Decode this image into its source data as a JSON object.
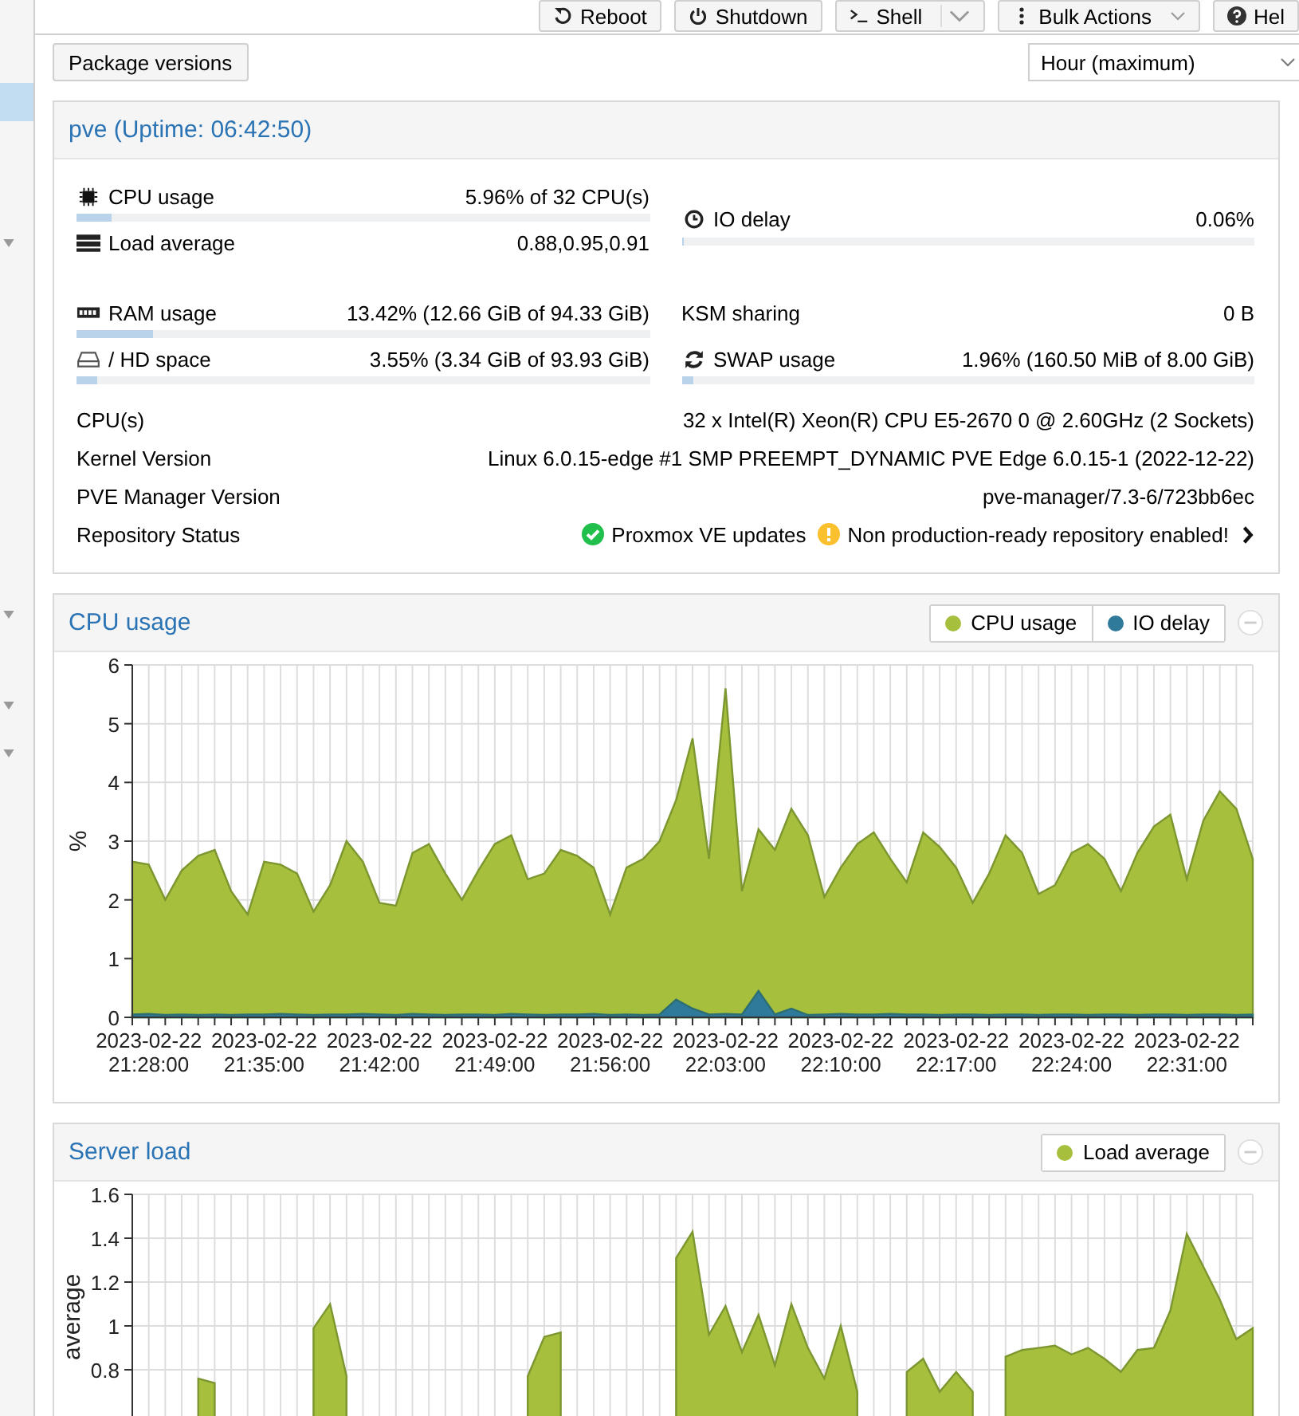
{
  "toolbar": {
    "buttons": [
      {
        "label": "Reboot",
        "kind": "plain"
      },
      {
        "label": "Shutdown",
        "kind": "plain"
      },
      {
        "label": "Shell",
        "kind": "split"
      },
      {
        "label": "Bulk Actions",
        "kind": "menu"
      },
      {
        "label": "Hel",
        "kind": "plain"
      }
    ]
  },
  "package_button": "Package versions",
  "timeframe": {
    "value": "Hour (maximum)"
  },
  "status": {
    "title": "pve (Uptime: 06:42:50)",
    "groups": [
      {
        "left": [
          {
            "label": "CPU usage",
            "value": "5.96% of 32 CPU(s)",
            "kind": "bar",
            "level": 0.06
          },
          {
            "label": "Load average",
            "value": "0.88,0.95,0.91",
            "kind": "plain"
          }
        ],
        "right": [
          {
            "label": "IO delay",
            "value": "0.06%",
            "kind": "bar",
            "level": 0.0006
          }
        ]
      },
      {
        "left": [
          {
            "label": "RAM usage",
            "value": "13.42% (12.66 GiB of 94.33 GiB)",
            "kind": "bar",
            "level": 0.1342
          },
          {
            "label": "/ HD space",
            "value": "3.55% (3.34 GiB of 93.93 GiB)",
            "kind": "bar",
            "level": 0.0355
          }
        ],
        "right": [
          {
            "label": "KSM sharing",
            "value": "0 B",
            "kind": "plain"
          },
          {
            "label": "SWAP usage",
            "value": "1.96% (160.50 MiB of 8.00 GiB)",
            "kind": "bar",
            "level": 0.0196
          }
        ]
      }
    ],
    "info": [
      {
        "label": "CPU(s)",
        "value": "32 x Intel(R) Xeon(R) CPU E5-2670 0 @ 2.60GHz (2 Sockets)"
      },
      {
        "label": "Kernel Version",
        "value": "Linux 6.0.15-edge #1 SMP PREEMPT_DYNAMIC PVE Edge 6.0.15-1 (2022-12-22)"
      },
      {
        "label": "PVE Manager Version",
        "value": "pve-manager/7.3-6/723bb6ec"
      }
    ],
    "repository": {
      "label": "Repository Status",
      "items": [
        {
          "kind": "ok",
          "text": "Proxmox VE updates"
        },
        {
          "kind": "warning",
          "text": "Non production-ready repository enabled!"
        }
      ]
    }
  },
  "panels": [
    {
      "title": "CPU usage",
      "chart_data": {
        "type": "area",
        "ylabel": "%",
        "grid": true,
        "categories": [
          null,
          "2023-02-22 21:28:00",
          null,
          null,
          null,
          null,
          null,
          null,
          "2023-02-22 21:35:00",
          null,
          null,
          null,
          null,
          null,
          null,
          "2023-02-22 21:42:00",
          null,
          null,
          null,
          null,
          null,
          null,
          "2023-02-22 21:49:00",
          null,
          null,
          null,
          null,
          null,
          null,
          "2023-02-22 21:56:00",
          null,
          null,
          null,
          null,
          null,
          null,
          "2023-02-22 22:03:00",
          null,
          null,
          null,
          null,
          null,
          null,
          "2023-02-22 22:10:00",
          null,
          null,
          null,
          null,
          null,
          null,
          "2023-02-22 22:17:00",
          null,
          null,
          null,
          null,
          null,
          null,
          "2023-02-22 22:24:00",
          null,
          null,
          null,
          null,
          null,
          null,
          "2023-02-22 22:31:00",
          null,
          null,
          null,
          null
        ],
        "series": [
          {
            "name": "CPU usage",
            "color": "#a6bf3c",
            "values": [
              2.65,
              2.6,
              2.0,
              2.5,
              2.75,
              2.85,
              2.15,
              1.75,
              2.65,
              2.6,
              2.45,
              1.8,
              2.25,
              3.0,
              2.65,
              1.95,
              1.9,
              2.8,
              2.95,
              2.45,
              2.0,
              2.5,
              2.95,
              3.1,
              2.35,
              2.45,
              2.85,
              2.75,
              2.55,
              1.75,
              2.55,
              2.7,
              3.0,
              3.7,
              4.75,
              2.7,
              5.6,
              2.15,
              3.2,
              2.85,
              3.55,
              3.1,
              2.05,
              2.55,
              2.95,
              3.15,
              2.7,
              2.3,
              3.15,
              2.9,
              2.55,
              1.95,
              2.45,
              3.1,
              2.8,
              2.1,
              2.25,
              2.8,
              2.95,
              2.7,
              2.15,
              2.8,
              3.25,
              3.45,
              2.35,
              3.35,
              3.85,
              3.55,
              2.7
            ]
          },
          {
            "name": "IO delay",
            "color": "#2f7a9a",
            "values": [
              0.05,
              0.06,
              0.04,
              0.05,
              0.04,
              0.05,
              0.04,
              0.05,
              0.05,
              0.06,
              0.05,
              0.04,
              0.05,
              0.05,
              0.06,
              0.05,
              0.04,
              0.06,
              0.05,
              0.04,
              0.05,
              0.05,
              0.04,
              0.06,
              0.05,
              0.04,
              0.05,
              0.05,
              0.06,
              0.04,
              0.05,
              0.04,
              0.05,
              0.3,
              0.15,
              0.05,
              0.06,
              0.05,
              0.45,
              0.05,
              0.15,
              0.04,
              0.05,
              0.06,
              0.05,
              0.05,
              0.06,
              0.05,
              0.05,
              0.04,
              0.05,
              0.05,
              0.04,
              0.05,
              0.05,
              0.04,
              0.05,
              0.05,
              0.04,
              0.05,
              0.05,
              0.04,
              0.05,
              0.05,
              0.04,
              0.05,
              0.05,
              0.04,
              0.05
            ]
          }
        ],
        "ylim": [
          0,
          6
        ],
        "yticks": [
          0,
          1,
          2,
          3,
          4,
          5,
          6
        ]
      }
    },
    {
      "title": "Server load",
      "chart_data": {
        "type": "area",
        "ylabel": "average",
        "grid": true,
        "categories": [
          null,
          null,
          null,
          null,
          null,
          null,
          null,
          null,
          null,
          null,
          null,
          null,
          null,
          null,
          null,
          null,
          null,
          null,
          null,
          null,
          null,
          null,
          null,
          null,
          null,
          null,
          null,
          null,
          null,
          null,
          null,
          null,
          null,
          null,
          null,
          null,
          null,
          null,
          null,
          null,
          null,
          null,
          null,
          null,
          null,
          null,
          null,
          null,
          null,
          null,
          null,
          null,
          null,
          null,
          null,
          null,
          null,
          null,
          null,
          null,
          null,
          null,
          null,
          null,
          null,
          null,
          null,
          null,
          null
        ],
        "series": [
          {
            "name": "Load average",
            "color": "#a6bf3c",
            "values": [
              null,
              null,
              null,
              null,
              0.76,
              0.74,
              null,
              null,
              null,
              null,
              null,
              0.99,
              1.1,
              0.77,
              null,
              null,
              null,
              null,
              null,
              null,
              null,
              null,
              null,
              null,
              0.77,
              0.95,
              0.97,
              null,
              null,
              null,
              null,
              null,
              null,
              1.31,
              1.43,
              0.96,
              1.09,
              0.88,
              1.05,
              0.82,
              1.1,
              0.9,
              0.76,
              1.0,
              0.7,
              null,
              null,
              0.79,
              0.85,
              0.7,
              0.79,
              0.7,
              null,
              0.86,
              0.89,
              0.9,
              0.91,
              0.87,
              0.9,
              0.85,
              0.79,
              0.89,
              0.9,
              1.07,
              1.42,
              1.27,
              1.12,
              0.94,
              0.99
            ]
          }
        ],
        "ylim": [
          0,
          1.6
        ],
        "yticks": [
          0.8,
          1,
          1.2,
          1.4,
          1.6
        ]
      }
    }
  ]
}
